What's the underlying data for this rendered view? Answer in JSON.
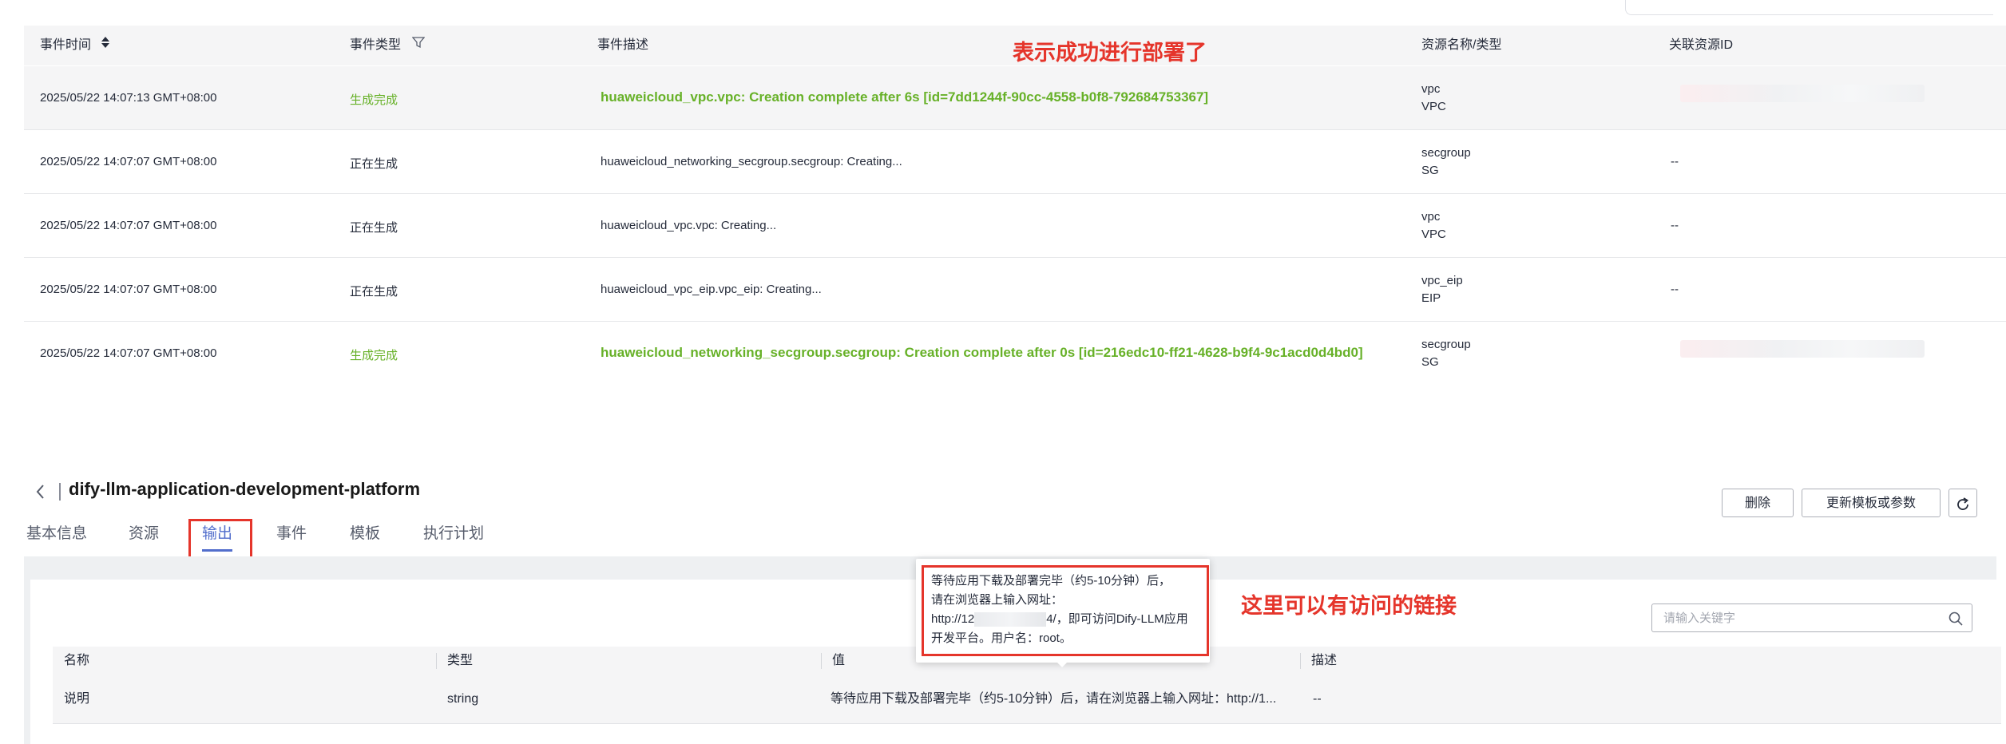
{
  "events": {
    "columns": {
      "time": "事件时间",
      "type": "事件类型",
      "desc": "事件描述",
      "resource": "资源名称/类型",
      "resource_id": "关联资源ID"
    },
    "annotation": "表示成功进行部署了",
    "rows": [
      {
        "time": "2025/05/22 14:07:13 GMT+08:00",
        "type": "生成完成",
        "desc": "huaweicloud_vpc.vpc: Creation complete after 6s [id=7dd1244f-90cc-4558-b0f8-792684753367]",
        "res_name": "vpc",
        "res_type": "VPC",
        "res_id": ""
      },
      {
        "time": "2025/05/22 14:07:07 GMT+08:00",
        "type": "正在生成",
        "desc": "huaweicloud_networking_secgroup.secgroup: Creating...",
        "res_name": "secgroup",
        "res_type": "SG",
        "res_id": "--"
      },
      {
        "time": "2025/05/22 14:07:07 GMT+08:00",
        "type": "正在生成",
        "desc": "huaweicloud_vpc.vpc: Creating...",
        "res_name": "vpc",
        "res_type": "VPC",
        "res_id": "--"
      },
      {
        "time": "2025/05/22 14:07:07 GMT+08:00",
        "type": "正在生成",
        "desc": "huaweicloud_vpc_eip.vpc_eip: Creating...",
        "res_name": "vpc_eip",
        "res_type": "EIP",
        "res_id": "--"
      },
      {
        "time": "2025/05/22 14:07:07 GMT+08:00",
        "type": "生成完成",
        "desc": "huaweicloud_networking_secgroup.secgroup: Creation complete after 0s [id=216edc10-ff21-4628-b9f4-9c1acd0d4bd0]",
        "res_name": "secgroup",
        "res_type": "SG",
        "res_id": ""
      }
    ]
  },
  "stack": {
    "title": "dify-llm-application-development-platform",
    "buttons": {
      "delete": "删除",
      "update": "更新模板或参数"
    },
    "tabs": [
      "基本信息",
      "资源",
      "输出",
      "事件",
      "模板",
      "执行计划"
    ],
    "active_tab": "输出"
  },
  "outputs": {
    "annotation": "这里可以有访问的链接",
    "search_placeholder": "请输入关键字",
    "columns": {
      "name": "名称",
      "type": "类型",
      "value": "值",
      "desc": "描述"
    },
    "rows": [
      {
        "name": "说明",
        "type": "string",
        "value": "等待应用下载及部署完毕（约5-10分钟）后，请在浏览器上输入网址：http://1...",
        "desc": "--"
      }
    ],
    "tooltip": {
      "line1": "等待应用下载及部署完毕（约5-10分钟）后，",
      "line2": "请在浏览器上输入网址：",
      "line3_prefix": "http://12",
      "line3_suffix": "4/，即可访问Dify-LLM应用",
      "line4": "开发平台。用户名：root。"
    }
  },
  "colors": {
    "accent": "#526ecc",
    "success": "#67b128",
    "annotation": "#e5352b"
  }
}
